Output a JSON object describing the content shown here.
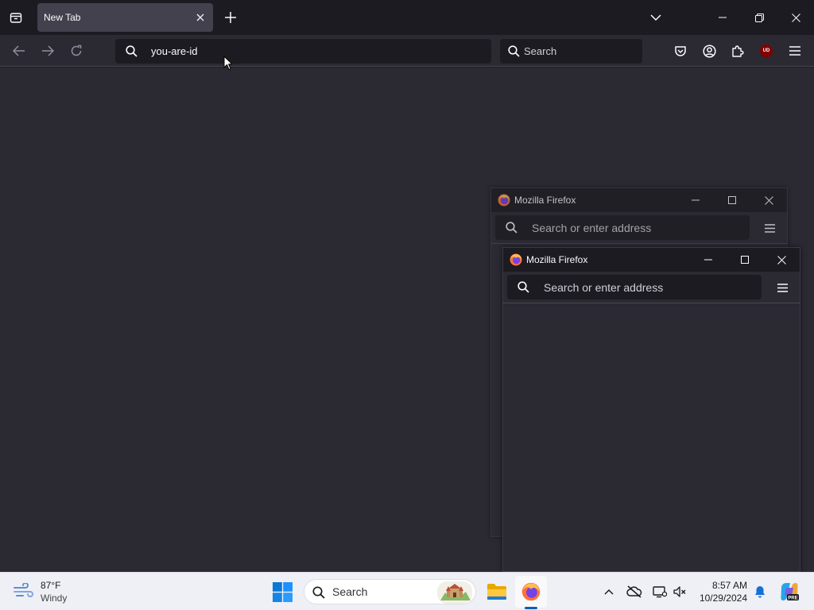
{
  "browser": {
    "tab": {
      "title": "New Tab"
    },
    "urlbar": {
      "value": "you-are-id"
    },
    "searchbar": {
      "placeholder": "Search"
    },
    "extension_badge": "UD"
  },
  "windows": [
    {
      "title": "Mozilla Firefox",
      "address_placeholder": "Search or enter address"
    },
    {
      "title": "Mozilla Firefox",
      "address_placeholder": "Search or enter address"
    }
  ],
  "taskbar": {
    "weather": {
      "temp": "87°F",
      "condition": "Windy"
    },
    "search": {
      "placeholder": "Search"
    },
    "clock": {
      "time": "8:57 AM",
      "date": "10/29/2024"
    },
    "copilot_badge": "PRE"
  },
  "colors": {
    "titlebar": "#1c1b22",
    "toolbar": "#2b2a33",
    "tab_active": "#42414d",
    "taskbar": "#eef0f5",
    "accent": "#005fb8"
  }
}
